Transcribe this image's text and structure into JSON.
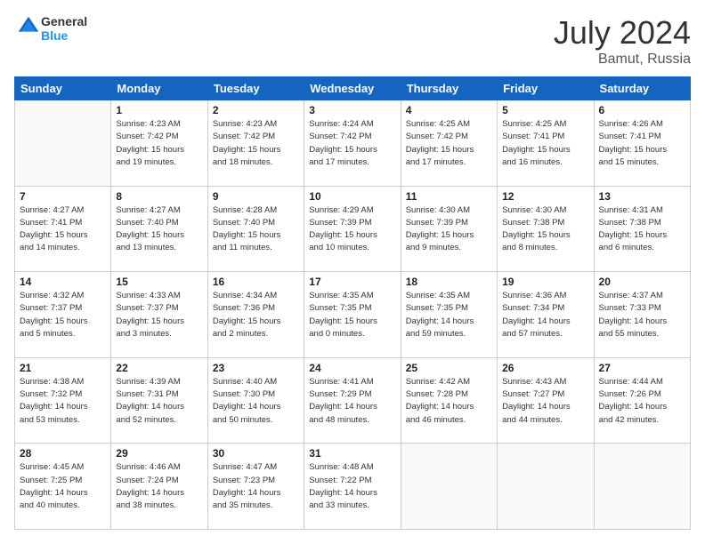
{
  "logo": {
    "text_general": "General",
    "text_blue": "Blue"
  },
  "title": "July 2024",
  "location": "Bamut, Russia",
  "days_of_week": [
    "Sunday",
    "Monday",
    "Tuesday",
    "Wednesday",
    "Thursday",
    "Friday",
    "Saturday"
  ],
  "weeks": [
    [
      {
        "day": "",
        "empty": true
      },
      {
        "day": "1",
        "sunrise": "Sunrise: 4:23 AM",
        "sunset": "Sunset: 7:42 PM",
        "daylight": "Daylight: 15 hours and 19 minutes."
      },
      {
        "day": "2",
        "sunrise": "Sunrise: 4:23 AM",
        "sunset": "Sunset: 7:42 PM",
        "daylight": "Daylight: 15 hours and 18 minutes."
      },
      {
        "day": "3",
        "sunrise": "Sunrise: 4:24 AM",
        "sunset": "Sunset: 7:42 PM",
        "daylight": "Daylight: 15 hours and 17 minutes."
      },
      {
        "day": "4",
        "sunrise": "Sunrise: 4:25 AM",
        "sunset": "Sunset: 7:42 PM",
        "daylight": "Daylight: 15 hours and 17 minutes."
      },
      {
        "day": "5",
        "sunrise": "Sunrise: 4:25 AM",
        "sunset": "Sunset: 7:41 PM",
        "daylight": "Daylight: 15 hours and 16 minutes."
      },
      {
        "day": "6",
        "sunrise": "Sunrise: 4:26 AM",
        "sunset": "Sunset: 7:41 PM",
        "daylight": "Daylight: 15 hours and 15 minutes."
      }
    ],
    [
      {
        "day": "7",
        "sunrise": "Sunrise: 4:27 AM",
        "sunset": "Sunset: 7:41 PM",
        "daylight": "Daylight: 15 hours and 14 minutes."
      },
      {
        "day": "8",
        "sunrise": "Sunrise: 4:27 AM",
        "sunset": "Sunset: 7:40 PM",
        "daylight": "Daylight: 15 hours and 13 minutes."
      },
      {
        "day": "9",
        "sunrise": "Sunrise: 4:28 AM",
        "sunset": "Sunset: 7:40 PM",
        "daylight": "Daylight: 15 hours and 11 minutes."
      },
      {
        "day": "10",
        "sunrise": "Sunrise: 4:29 AM",
        "sunset": "Sunset: 7:39 PM",
        "daylight": "Daylight: 15 hours and 10 minutes."
      },
      {
        "day": "11",
        "sunrise": "Sunrise: 4:30 AM",
        "sunset": "Sunset: 7:39 PM",
        "daylight": "Daylight: 15 hours and 9 minutes."
      },
      {
        "day": "12",
        "sunrise": "Sunrise: 4:30 AM",
        "sunset": "Sunset: 7:38 PM",
        "daylight": "Daylight: 15 hours and 8 minutes."
      },
      {
        "day": "13",
        "sunrise": "Sunrise: 4:31 AM",
        "sunset": "Sunset: 7:38 PM",
        "daylight": "Daylight: 15 hours and 6 minutes."
      }
    ],
    [
      {
        "day": "14",
        "sunrise": "Sunrise: 4:32 AM",
        "sunset": "Sunset: 7:37 PM",
        "daylight": "Daylight: 15 hours and 5 minutes."
      },
      {
        "day": "15",
        "sunrise": "Sunrise: 4:33 AM",
        "sunset": "Sunset: 7:37 PM",
        "daylight": "Daylight: 15 hours and 3 minutes."
      },
      {
        "day": "16",
        "sunrise": "Sunrise: 4:34 AM",
        "sunset": "Sunset: 7:36 PM",
        "daylight": "Daylight: 15 hours and 2 minutes."
      },
      {
        "day": "17",
        "sunrise": "Sunrise: 4:35 AM",
        "sunset": "Sunset: 7:35 PM",
        "daylight": "Daylight: 15 hours and 0 minutes."
      },
      {
        "day": "18",
        "sunrise": "Sunrise: 4:35 AM",
        "sunset": "Sunset: 7:35 PM",
        "daylight": "Daylight: 14 hours and 59 minutes."
      },
      {
        "day": "19",
        "sunrise": "Sunrise: 4:36 AM",
        "sunset": "Sunset: 7:34 PM",
        "daylight": "Daylight: 14 hours and 57 minutes."
      },
      {
        "day": "20",
        "sunrise": "Sunrise: 4:37 AM",
        "sunset": "Sunset: 7:33 PM",
        "daylight": "Daylight: 14 hours and 55 minutes."
      }
    ],
    [
      {
        "day": "21",
        "sunrise": "Sunrise: 4:38 AM",
        "sunset": "Sunset: 7:32 PM",
        "daylight": "Daylight: 14 hours and 53 minutes."
      },
      {
        "day": "22",
        "sunrise": "Sunrise: 4:39 AM",
        "sunset": "Sunset: 7:31 PM",
        "daylight": "Daylight: 14 hours and 52 minutes."
      },
      {
        "day": "23",
        "sunrise": "Sunrise: 4:40 AM",
        "sunset": "Sunset: 7:30 PM",
        "daylight": "Daylight: 14 hours and 50 minutes."
      },
      {
        "day": "24",
        "sunrise": "Sunrise: 4:41 AM",
        "sunset": "Sunset: 7:29 PM",
        "daylight": "Daylight: 14 hours and 48 minutes."
      },
      {
        "day": "25",
        "sunrise": "Sunrise: 4:42 AM",
        "sunset": "Sunset: 7:28 PM",
        "daylight": "Daylight: 14 hours and 46 minutes."
      },
      {
        "day": "26",
        "sunrise": "Sunrise: 4:43 AM",
        "sunset": "Sunset: 7:27 PM",
        "daylight": "Daylight: 14 hours and 44 minutes."
      },
      {
        "day": "27",
        "sunrise": "Sunrise: 4:44 AM",
        "sunset": "Sunset: 7:26 PM",
        "daylight": "Daylight: 14 hours and 42 minutes."
      }
    ],
    [
      {
        "day": "28",
        "sunrise": "Sunrise: 4:45 AM",
        "sunset": "Sunset: 7:25 PM",
        "daylight": "Daylight: 14 hours and 40 minutes."
      },
      {
        "day": "29",
        "sunrise": "Sunrise: 4:46 AM",
        "sunset": "Sunset: 7:24 PM",
        "daylight": "Daylight: 14 hours and 38 minutes."
      },
      {
        "day": "30",
        "sunrise": "Sunrise: 4:47 AM",
        "sunset": "Sunset: 7:23 PM",
        "daylight": "Daylight: 14 hours and 35 minutes."
      },
      {
        "day": "31",
        "sunrise": "Sunrise: 4:48 AM",
        "sunset": "Sunset: 7:22 PM",
        "daylight": "Daylight: 14 hours and 33 minutes."
      },
      {
        "day": "",
        "empty": true
      },
      {
        "day": "",
        "empty": true
      },
      {
        "day": "",
        "empty": true
      }
    ]
  ]
}
